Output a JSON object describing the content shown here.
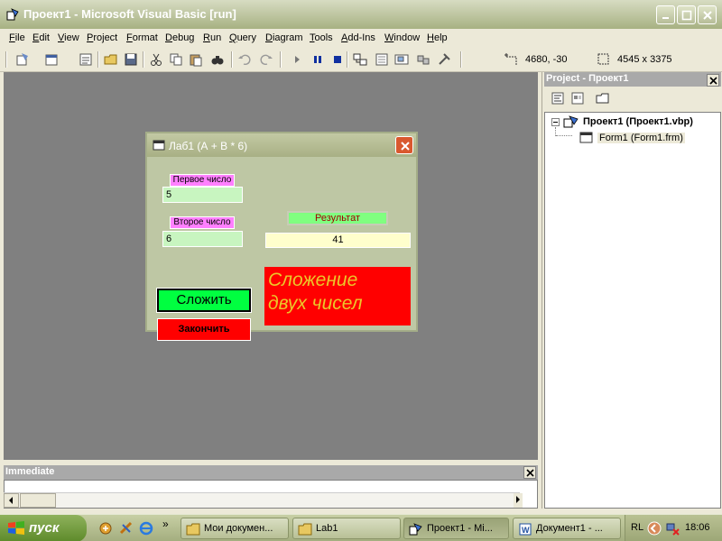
{
  "window": {
    "title": "Проект1 - Microsoft Visual Basic [run]"
  },
  "menu": {
    "items": [
      "File",
      "Edit",
      "View",
      "Project",
      "Format",
      "Debug",
      "Run",
      "Query",
      "Diagram",
      "Tools",
      "Add-Ins",
      "Window",
      "Help"
    ]
  },
  "toolbar": {
    "position_readout": "4680, -30",
    "size_readout": "4545 x 3375"
  },
  "form": {
    "title": "Лаб1 (А + В * 6)",
    "first_label": "Первое число",
    "first_value": "5",
    "second_label": "Второе число",
    "second_value": "6",
    "result_label": "Результат",
    "result_value": "41",
    "add_button": "Сложить",
    "exit_button": "Закончить",
    "caption_line1": "Сложение",
    "caption_line2": "двух чисел"
  },
  "immediate": {
    "title": "Immediate"
  },
  "project": {
    "title": "Project - Проект1",
    "project_node": "Проект1 (Проект1.vbp)",
    "form_node": "Form1 (Form1.frm)"
  },
  "taskbar": {
    "start_label": "пуск",
    "tasks": [
      "Мои докумен...",
      "Lab1",
      "Проект1 - Mi...",
      "Документ1 - ..."
    ],
    "lang": "RL",
    "clock": "18:06"
  },
  "colors": {
    "workspace": "#808080",
    "add_button": "#00ff40",
    "exit_button": "#ff0000",
    "caption_bg": "#ff0000",
    "caption_text": "#ecc72a",
    "input_bg": "#c8f5c0",
    "label_bg": "#ff80ff",
    "result_bg": "#ffffcc"
  }
}
